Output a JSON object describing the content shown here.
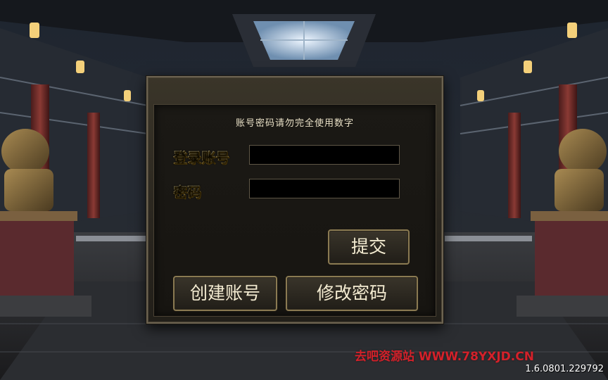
{
  "login": {
    "notice": "账号密码请勿完全使用数字",
    "account_label": "登录账号",
    "account_value": "",
    "password_label": "密码",
    "password_value": "",
    "submit_label": "提交",
    "create_account_label": "创建账号",
    "change_password_label": "修改密码"
  },
  "footer": {
    "watermark": "去吧资源站 WWW.78YXJD.CN",
    "version": "1.6.0801.229792"
  },
  "colors": {
    "label_gold": "#f7dc6f",
    "watermark_red": "#d3212a",
    "panel_border": "#6b6250"
  }
}
